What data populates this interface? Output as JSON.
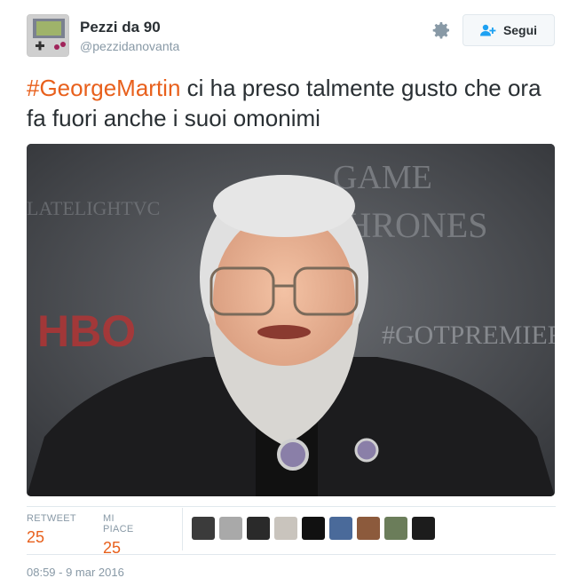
{
  "account": {
    "display_name": "Pezzi da 90",
    "handle": "@pezzidanovanta",
    "avatar_icon": "gameboy-icon"
  },
  "actions": {
    "follow_label": "Segui",
    "follow_icon": "add-user-icon",
    "settings_icon": "gear-icon"
  },
  "tweet": {
    "hashtag": "#GeorgeMartin",
    "text": " ci ha preso talmente gusto che ora fa fuori anche i suoi omonimi"
  },
  "photo": {
    "backdrop_texts": [
      "GAME",
      "THRONES",
      "HBO",
      "#GOTPREMIERE",
      "LATELIGHTVC"
    ]
  },
  "stats": {
    "retweet_label": "RETWEET",
    "retweet_count": "25",
    "like_label": "MI PIACE",
    "like_count": "25"
  },
  "likers": [
    "#3b3b3b",
    "#a9a9a9",
    "#2a2a2a",
    "#c9c4bd",
    "#111111",
    "#4a6a9a",
    "#8c5a3c",
    "#6b7d5a",
    "#1c1c1c"
  ],
  "timestamp": "08:59 - 9 mar 2016",
  "colors": {
    "accent": "#e8601c",
    "muted": "#8899a6",
    "text": "#292f33"
  }
}
